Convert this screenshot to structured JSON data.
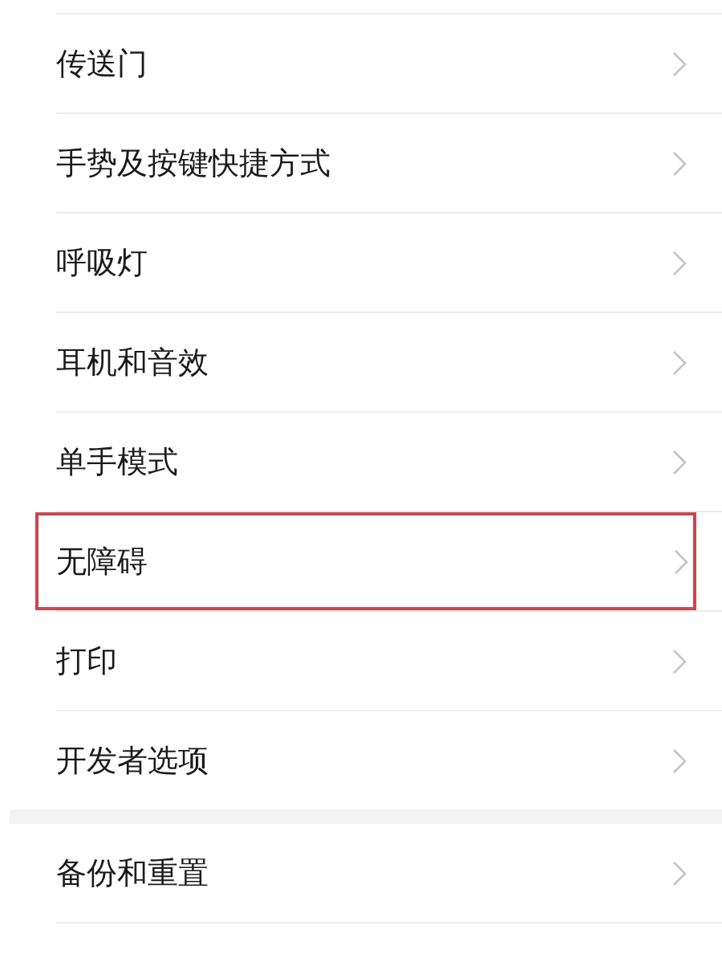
{
  "groups": [
    {
      "items": [
        {
          "label": "传送门",
          "highlighted": false
        },
        {
          "label": "手势及按键快捷方式",
          "highlighted": false
        },
        {
          "label": "呼吸灯",
          "highlighted": false
        },
        {
          "label": "耳机和音效",
          "highlighted": false
        },
        {
          "label": "单手模式",
          "highlighted": false
        },
        {
          "label": "无障碍",
          "highlighted": true
        },
        {
          "label": "打印",
          "highlighted": false
        },
        {
          "label": "开发者选项",
          "highlighted": false
        }
      ]
    },
    {
      "items": [
        {
          "label": "备份和重置",
          "highlighted": false
        }
      ]
    }
  ]
}
